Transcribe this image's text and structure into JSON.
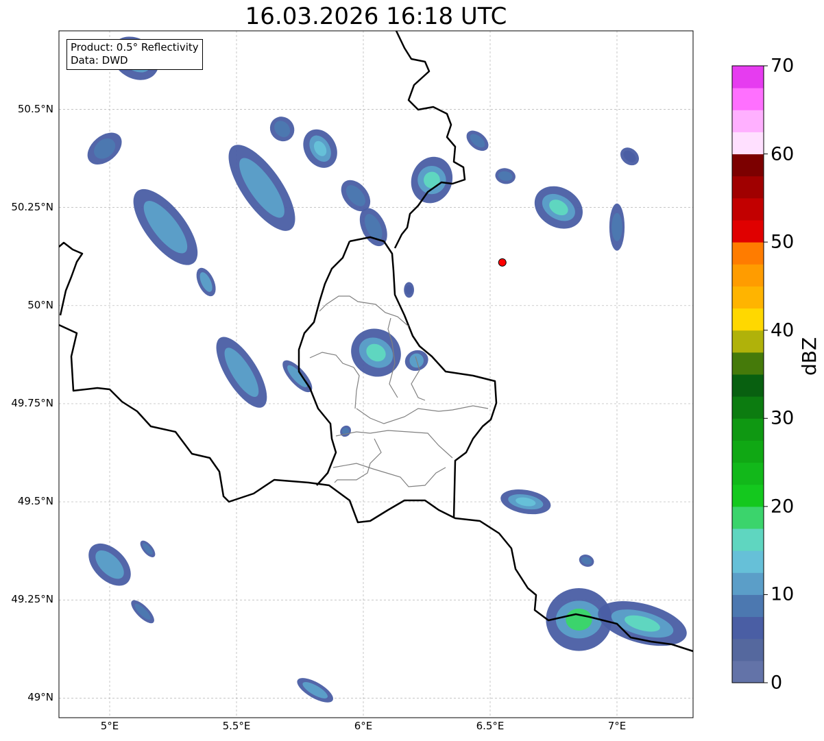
{
  "title": "16.03.2026 16:18 UTC",
  "info": {
    "product": "Product: 0.5° Reflectivity",
    "data": "Data: DWD"
  },
  "lat_ticks": [
    {
      "label": "50.5°N",
      "value": 50.5
    },
    {
      "label": "50.25°N",
      "value": 50.25
    },
    {
      "label": "50°N",
      "value": 50.0
    },
    {
      "label": "49.75°N",
      "value": 49.75
    },
    {
      "label": "49.5°N",
      "value": 49.5
    },
    {
      "label": "49.25°N",
      "value": 49.25
    },
    {
      "label": "49°N",
      "value": 49.0
    }
  ],
  "lon_ticks": [
    {
      "label": "5°E",
      "value": 5.0
    },
    {
      "label": "5.5°E",
      "value": 5.5
    },
    {
      "label": "6°E",
      "value": 6.0
    },
    {
      "label": "6.5°E",
      "value": 6.5
    },
    {
      "label": "7°E",
      "value": 7.0
    }
  ],
  "extent": {
    "lon_min": 4.8,
    "lon_max": 7.3,
    "lat_min": 48.95,
    "lat_max": 50.7
  },
  "radar_site": {
    "lon": 6.548,
    "lat": 50.11,
    "color": "#ff0000"
  },
  "colorbar": {
    "label": "dBZ",
    "min": 0,
    "max": 70,
    "step": 2.5,
    "tick_labels": [
      "0",
      "10",
      "20",
      "30",
      "40",
      "50",
      "60",
      "70"
    ],
    "tick_values": [
      0,
      10,
      20,
      30,
      40,
      50,
      60,
      70
    ],
    "colors": [
      "#6373a8",
      "#55689e",
      "#4a5ea4",
      "#4c78b0",
      "#5b9ec8",
      "#66c0d8",
      "#5fd6c0",
      "#3bd46c",
      "#14c81e",
      "#12b81a",
      "#10a814",
      "#0f9812",
      "#0c7c10",
      "#086010",
      "#457a0a",
      "#b0b20a",
      "#ffd800",
      "#ffb400",
      "#ff9c00",
      "#ff7c00",
      "#e00000",
      "#c20000",
      "#a00000",
      "#7c0000",
      "#ffe0ff",
      "#ffb0ff",
      "#ff70ff",
      "#e63cf0"
    ]
  },
  "reflectivity_cells": [
    {
      "lon": 5.1,
      "lat": 50.63,
      "rx": 0.1,
      "ry": 0.05,
      "rot": 35,
      "dbz": 14
    },
    {
      "lon": 4.98,
      "lat": 50.4,
      "rx": 0.05,
      "ry": 0.05,
      "rot": 50,
      "dbz": 8
    },
    {
      "lon": 5.22,
      "lat": 50.2,
      "rx": 0.18,
      "ry": 0.05,
      "rot": 52,
      "dbz": 12
    },
    {
      "lon": 5.38,
      "lat": 50.06,
      "rx": 0.06,
      "ry": 0.02,
      "rot": 65,
      "dbz": 10
    },
    {
      "lon": 5.6,
      "lat": 50.3,
      "rx": 0.2,
      "ry": 0.05,
      "rot": 55,
      "dbz": 10
    },
    {
      "lon": 5.68,
      "lat": 50.45,
      "rx": 0.05,
      "ry": 0.03,
      "rot": 50,
      "dbz": 9
    },
    {
      "lon": 5.83,
      "lat": 50.4,
      "rx": 0.08,
      "ry": 0.04,
      "rot": 60,
      "dbz": 14
    },
    {
      "lon": 5.52,
      "lat": 49.83,
      "rx": 0.16,
      "ry": 0.04,
      "rot": 58,
      "dbz": 12
    },
    {
      "lon": 5.74,
      "lat": 49.82,
      "rx": 0.08,
      "ry": 0.02,
      "rot": 48,
      "dbz": 10
    },
    {
      "lon": 5.97,
      "lat": 50.28,
      "rx": 0.07,
      "ry": 0.03,
      "rot": 50,
      "dbz": 8
    },
    {
      "lon": 6.04,
      "lat": 50.2,
      "rx": 0.08,
      "ry": 0.03,
      "rot": 65,
      "dbz": 9
    },
    {
      "lon": 6.27,
      "lat": 50.32,
      "rx": 0.08,
      "ry": 0.06,
      "rot": 20,
      "dbz": 15
    },
    {
      "lon": 6.45,
      "lat": 50.42,
      "rx": 0.05,
      "ry": 0.02,
      "rot": 40,
      "dbz": 8
    },
    {
      "lon": 6.56,
      "lat": 50.33,
      "rx": 0.04,
      "ry": 0.02,
      "rot": 10,
      "dbz": 9
    },
    {
      "lon": 6.77,
      "lat": 50.25,
      "rx": 0.1,
      "ry": 0.05,
      "rot": 30,
      "dbz": 15
    },
    {
      "lon": 7.0,
      "lat": 50.2,
      "rx": 0.03,
      "ry": 0.06,
      "rot": 0,
      "dbz": 8
    },
    {
      "lon": 7.05,
      "lat": 50.38,
      "rx": 0.04,
      "ry": 0.02,
      "rot": 40,
      "dbz": 7
    },
    {
      "lon": 6.05,
      "lat": 49.88,
      "rx": 0.1,
      "ry": 0.06,
      "rot": 30,
      "dbz": 16
    },
    {
      "lon": 6.21,
      "lat": 49.86,
      "rx": 0.04,
      "ry": 0.03,
      "rot": 70,
      "dbz": 10
    },
    {
      "lon": 6.18,
      "lat": 50.04,
      "rx": 0.02,
      "ry": 0.02,
      "rot": 0,
      "dbz": 7
    },
    {
      "lon": 5.93,
      "lat": 49.68,
      "rx": 0.02,
      "ry": 0.015,
      "rot": 40,
      "dbz": 8
    },
    {
      "lon": 6.64,
      "lat": 49.5,
      "rx": 0.1,
      "ry": 0.03,
      "rot": 10,
      "dbz": 13
    },
    {
      "lon": 5.0,
      "lat": 49.34,
      "rx": 0.1,
      "ry": 0.04,
      "rot": 45,
      "dbz": 11
    },
    {
      "lon": 5.13,
      "lat": 49.22,
      "rx": 0.06,
      "ry": 0.015,
      "rot": 45,
      "dbz": 8
    },
    {
      "lon": 5.15,
      "lat": 49.38,
      "rx": 0.04,
      "ry": 0.012,
      "rot": 50,
      "dbz": 8
    },
    {
      "lon": 5.81,
      "lat": 49.02,
      "rx": 0.08,
      "ry": 0.02,
      "rot": 30,
      "dbz": 12
    },
    {
      "lon": 6.85,
      "lat": 49.2,
      "rx": 0.13,
      "ry": 0.08,
      "rot": 0,
      "dbz": 18
    },
    {
      "lon": 7.1,
      "lat": 49.19,
      "rx": 0.18,
      "ry": 0.05,
      "rot": 15,
      "dbz": 15
    },
    {
      "lon": 6.88,
      "lat": 49.35,
      "rx": 0.03,
      "ry": 0.015,
      "rot": 20,
      "dbz": 8
    }
  ]
}
